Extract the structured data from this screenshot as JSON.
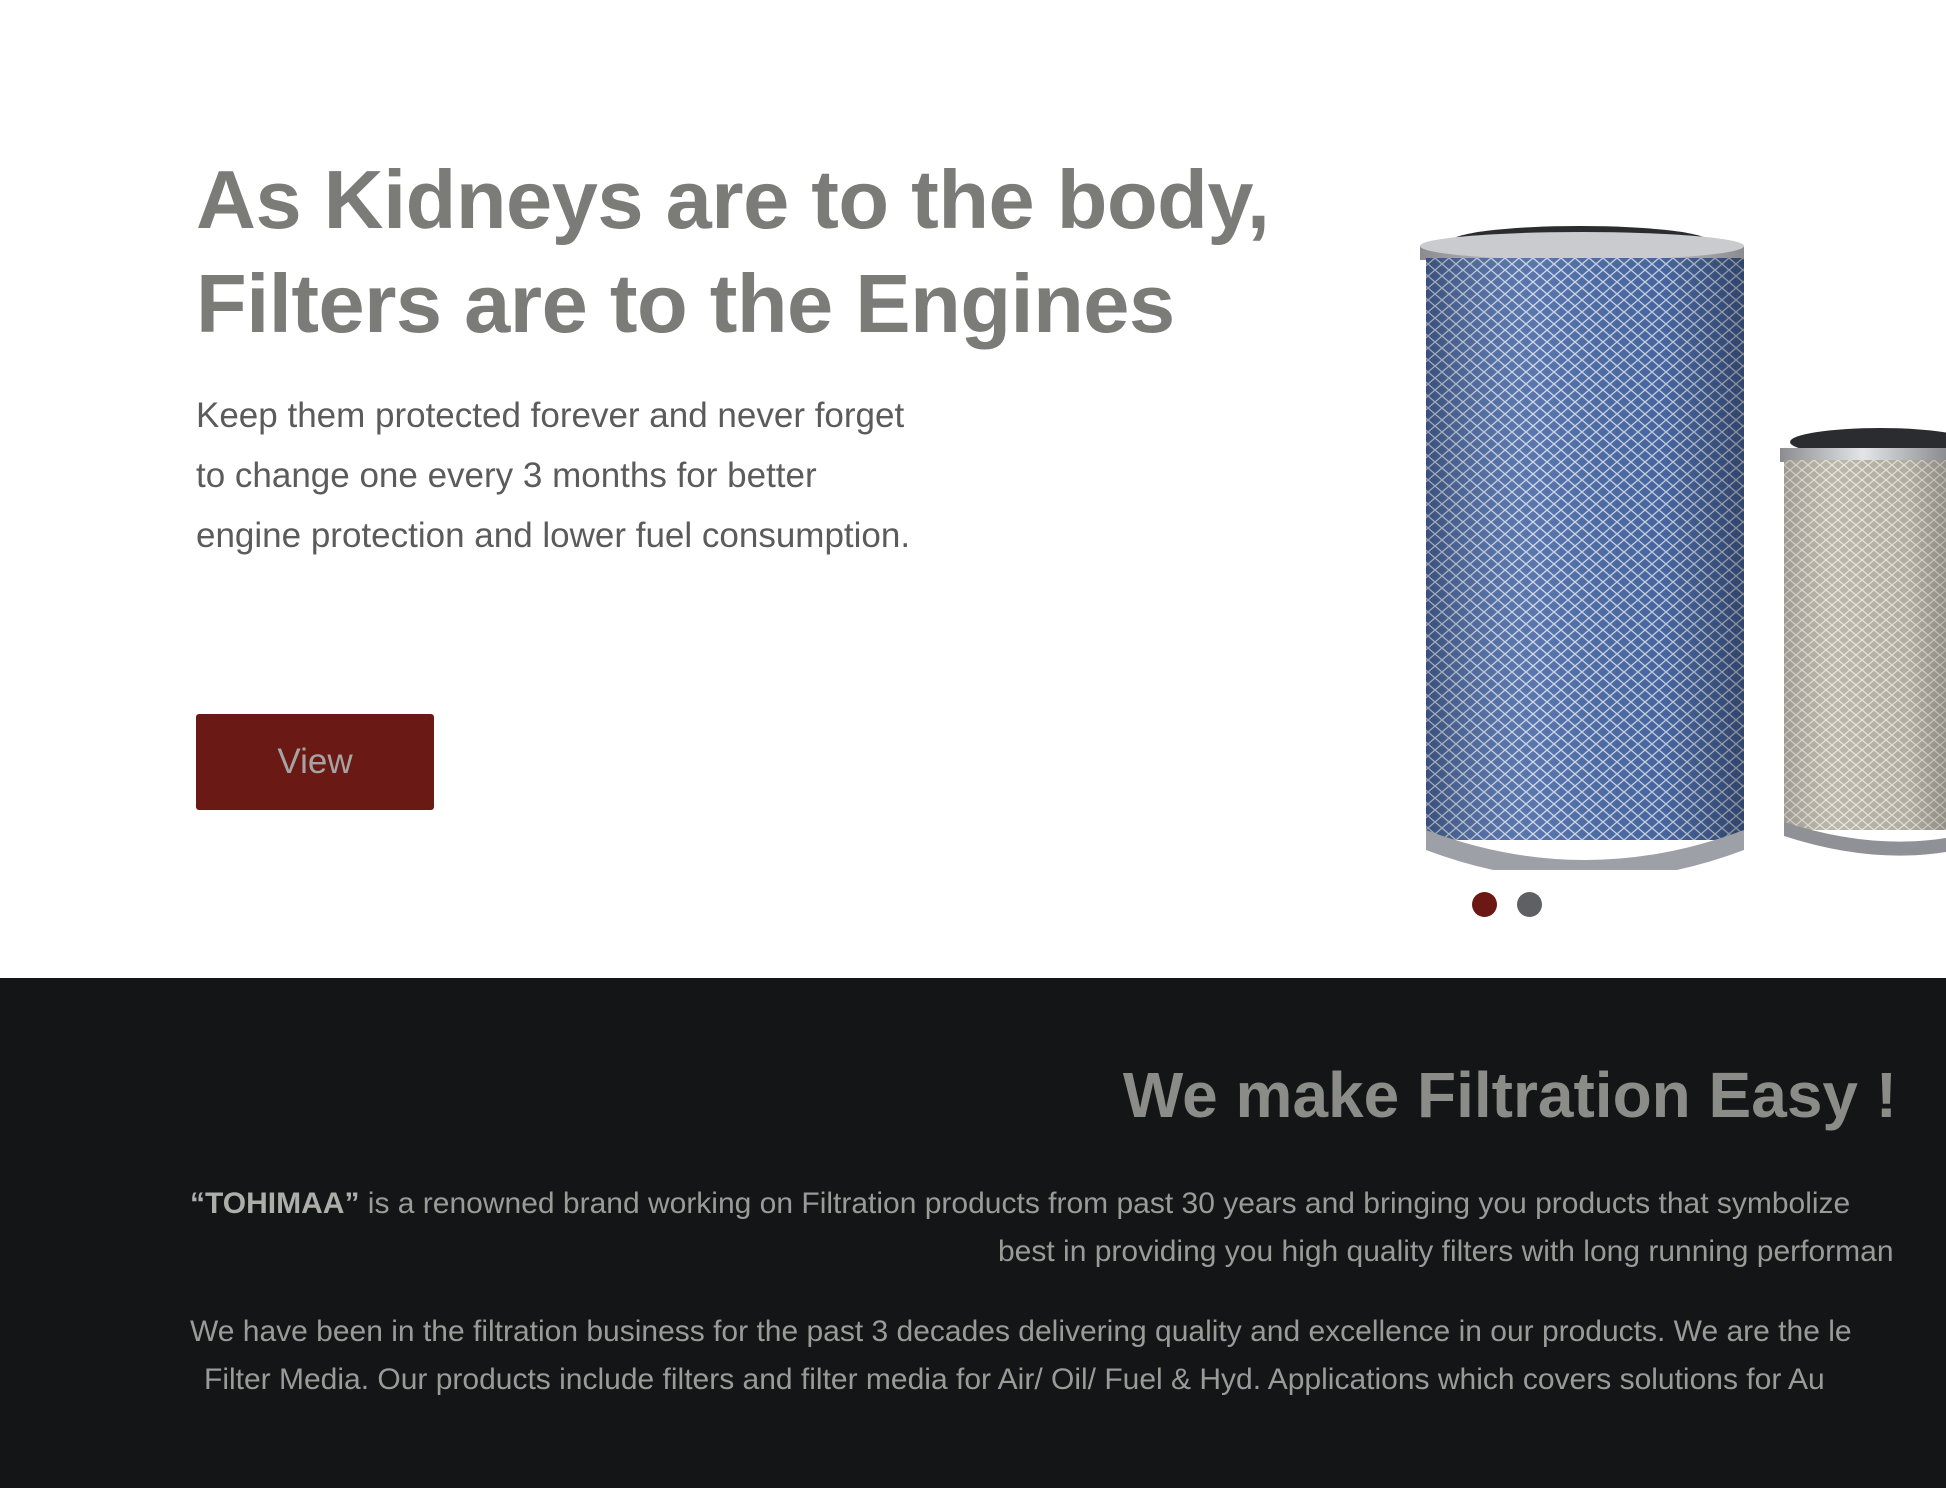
{
  "hero": {
    "title_line1": "As Kidneys are to the body,",
    "title_line2": "Filters are to the Engines",
    "subtitle_line1": "Keep them protected forever and never forget",
    "subtitle_line2": "to change one every 3 months for better",
    "subtitle_line3": "engine protection and lower fuel consumption.",
    "view_button_label": "View",
    "carousel": {
      "slide_count": 2,
      "active_index": 0
    }
  },
  "colors": {
    "brand_red": "#6a1914",
    "dark_section": "#141517",
    "heading_gray": "#7b7b78"
  },
  "about": {
    "title": "We make Filtration Easy !",
    "brand_name": "“TOHIMAA”",
    "p1_line1_rest": " is a renowned brand working on Filtration products from past 30 years and bringing you products that symbolize",
    "p1_line2": "best in providing you high quality filters with long running performan",
    "p2_line1": "We have been in the filtration business for the past 3 decades delivering quality and excellence in our products. We are the le",
    "p2_line2": "Filter Media. Our products include filters and filter media for Air/ Oil/ Fuel & Hyd. Applications which covers solutions for Au"
  }
}
